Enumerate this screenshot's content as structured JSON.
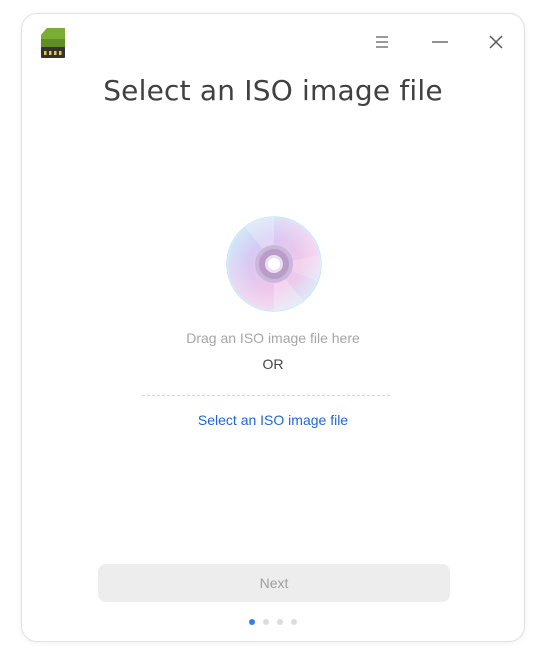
{
  "window": {
    "title": "Select an ISO image file",
    "menu_icon": "menu-icon",
    "minimize_icon": "minimize-icon",
    "close_icon": "close-icon",
    "app_icon": "sd-card-icon"
  },
  "dropzone": {
    "icon": "disc-icon",
    "drag_text": "Drag an ISO image file here",
    "or_text": "OR",
    "select_link": "Select an ISO image file"
  },
  "footer": {
    "next_label": "Next",
    "pages_total": 4,
    "current_page": 1
  },
  "colors": {
    "link": "#1d66d8",
    "active_dot": "#2f80ed",
    "app_icon_green": "#6c9a2a"
  }
}
